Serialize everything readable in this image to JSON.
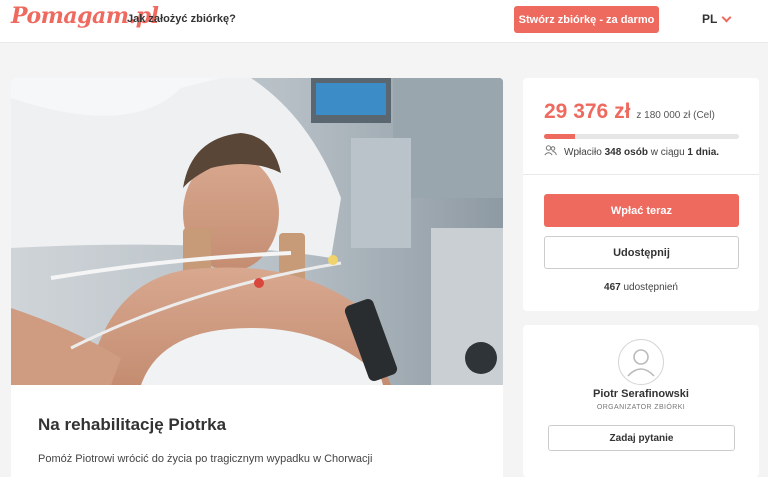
{
  "header": {
    "logo": "Pomagam.pl",
    "howto_link": "Jak założyć zbiórkę?",
    "create_button": "Stwórz zbiórkę - za darmo",
    "language": "PL"
  },
  "campaign": {
    "title": "Na rehabilitację Piotrka",
    "description": "Pomóż Piotrowi wrócić do życia po tragicznym wypadku w Chorwacji"
  },
  "stats": {
    "amount": "29 376 zł",
    "goal": "z 180 000 zł (Cel)",
    "progress_percent": 16,
    "donors_prefix": "Wpłaciło",
    "donors_count": "348 osób",
    "donors_mid": "w ciągu",
    "donors_period": "1 dnia.",
    "pay_button": "Wpłać teraz",
    "share_button": "Udostępnij",
    "share_count": "467",
    "share_label": "udostępnień"
  },
  "organizer": {
    "name": "Piotr Serafinowski",
    "role": "ORGANIZATOR ZBIÓRKI",
    "ask_button": "Zadaj pytanie"
  },
  "colors": {
    "accent": "#ee6a5f"
  }
}
